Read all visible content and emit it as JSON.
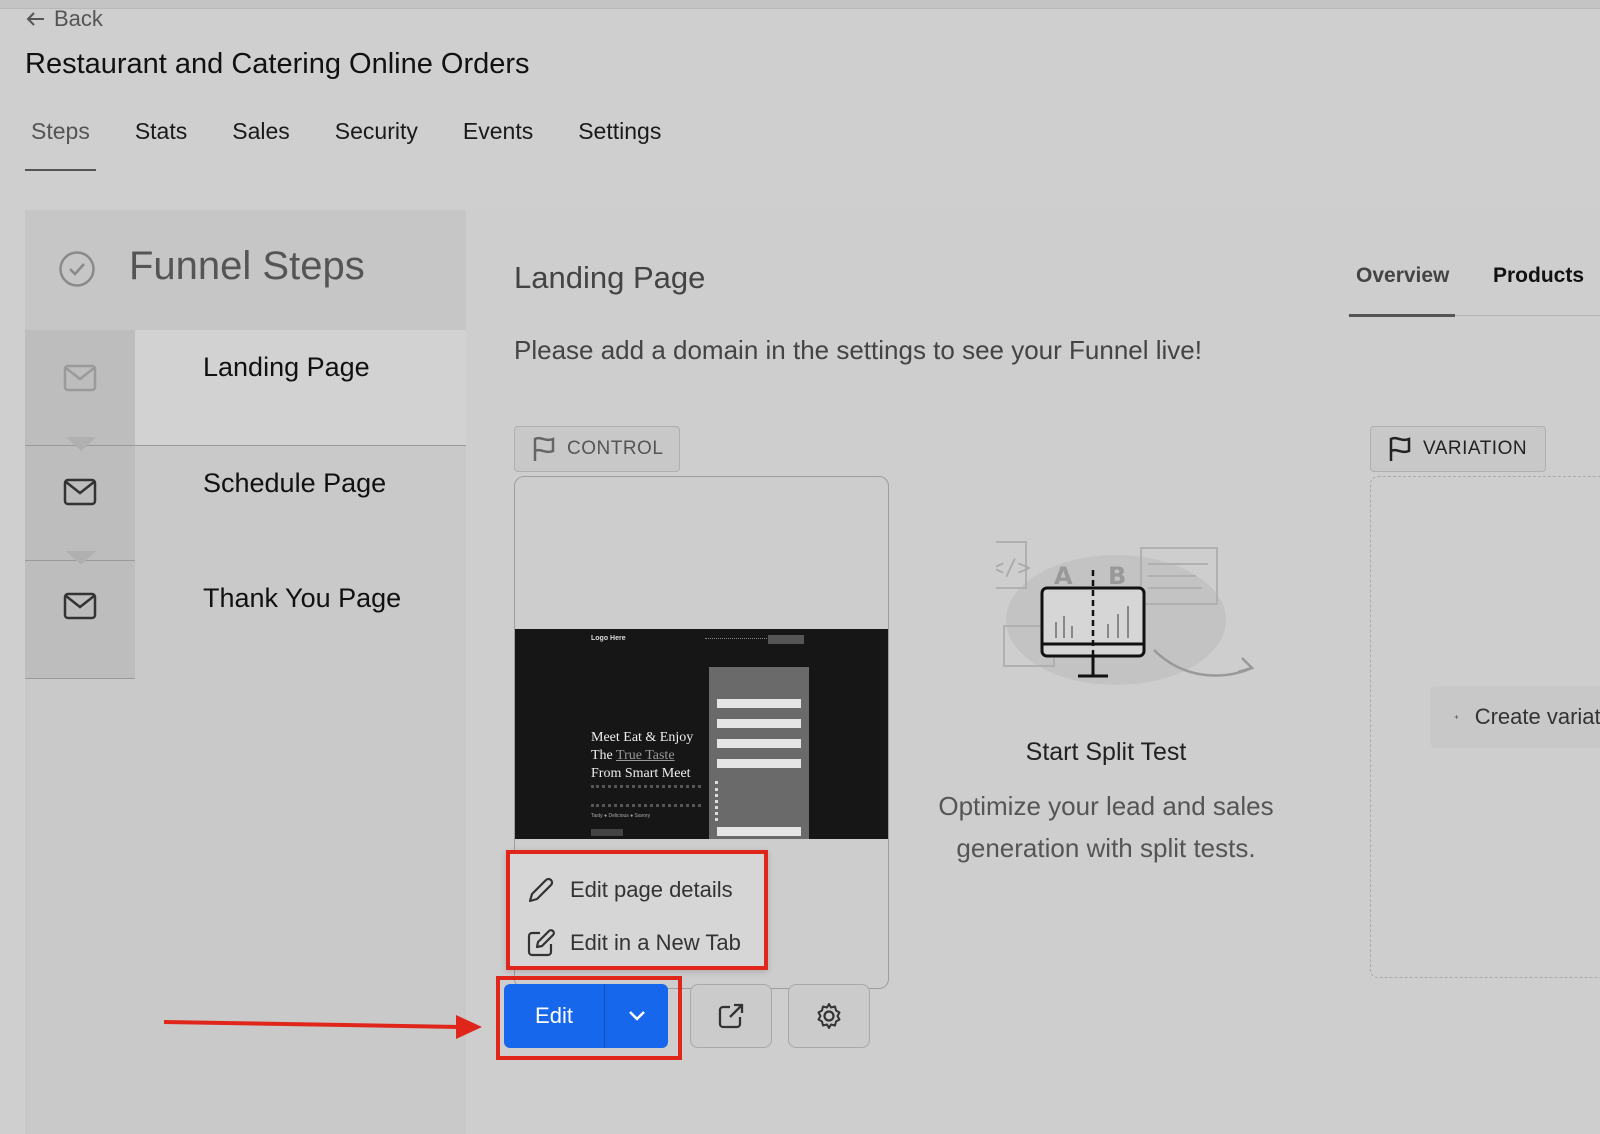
{
  "header": {
    "back_label": "Back",
    "title": "Restaurant and Catering Online Orders"
  },
  "tabs": [
    {
      "label": "Steps",
      "active": true
    },
    {
      "label": "Stats"
    },
    {
      "label": "Sales"
    },
    {
      "label": "Security"
    },
    {
      "label": "Events"
    },
    {
      "label": "Settings"
    }
  ],
  "sidebar": {
    "title": "Funnel Steps",
    "steps": [
      {
        "label": "Landing Page",
        "icon": "mail-icon",
        "active": true
      },
      {
        "label": "Schedule Page",
        "icon": "mail-icon"
      },
      {
        "label": "Thank You Page",
        "icon": "mail-icon"
      }
    ]
  },
  "main": {
    "title": "Landing Page",
    "tabs": [
      {
        "label": "Overview",
        "active": true
      },
      {
        "label": "Products"
      }
    ],
    "notice": "Please add a domain in the settings to see your Funnel live!",
    "control_label": "CONTROL",
    "variation_label": "VARIATION",
    "preview": {
      "logo": "Logo Here",
      "headline_1": "Meet Eat & Enjoy",
      "headline_2a": "The ",
      "headline_2b": "True Taste",
      "headline_3": "From Smart Meet",
      "tagline": "Tasty ● Delicious ● Savory"
    },
    "menu": {
      "edit_details": "Edit page details",
      "edit_new_tab": "Edit in a New Tab"
    },
    "edit_label": "Edit",
    "split": {
      "title": "Start Split Test",
      "description": "Optimize your lead and sales generation with split tests."
    },
    "create_variation": "Create variation"
  },
  "colors": {
    "primary": "#1767ed",
    "highlight": "#e0261b",
    "background": "#cfcfcf"
  }
}
